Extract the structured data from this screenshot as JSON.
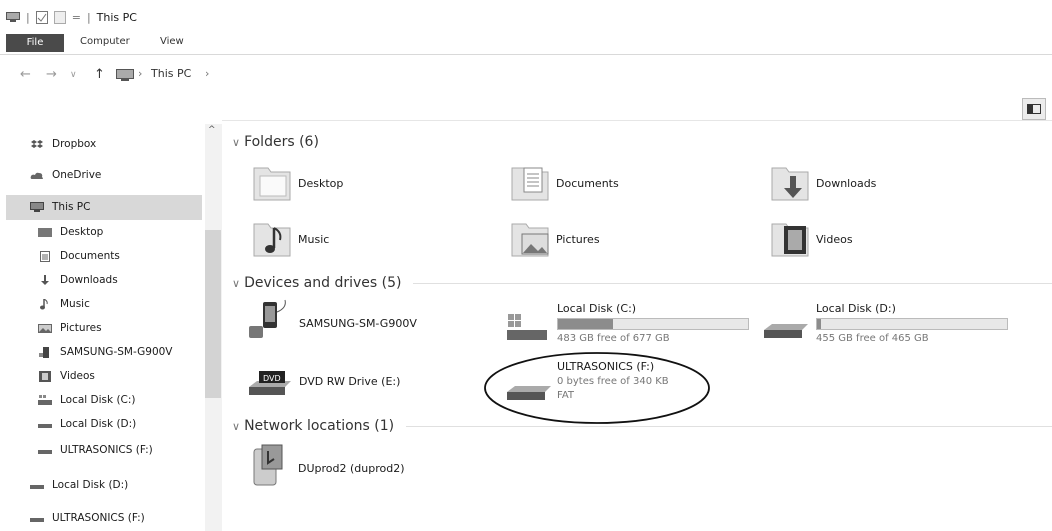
{
  "window": {
    "title": "This PC"
  },
  "ribbon": {
    "tabs": [
      "File",
      "Computer",
      "View"
    ]
  },
  "address": {
    "crumbs": [
      "This PC"
    ]
  },
  "nav_pane": {
    "items": [
      {
        "label": "Dropbox"
      },
      {
        "label": "OneDrive"
      },
      {
        "label": "This PC"
      },
      {
        "label": "Desktop"
      },
      {
        "label": "Documents"
      },
      {
        "label": "Downloads"
      },
      {
        "label": "Music"
      },
      {
        "label": "Pictures"
      },
      {
        "label": "SAMSUNG-SM-G900V"
      },
      {
        "label": "Videos"
      },
      {
        "label": "Local Disk (C:)"
      },
      {
        "label": "Local Disk (D:)"
      },
      {
        "label": "ULTRASONICS (F:)"
      },
      {
        "label": "Local Disk (D:)"
      },
      {
        "label": "ULTRASONICS (F:)"
      }
    ]
  },
  "content": {
    "folders_header": "Folders (6)",
    "folders": [
      "Desktop",
      "Documents",
      "Downloads",
      "Music",
      "Pictures",
      "Videos"
    ],
    "devices_header": "Devices and drives (5)",
    "devices": {
      "samsung": "SAMSUNG-SM-G900V",
      "dvd": "DVD RW Drive (E:)",
      "dvd_badge": "DVD",
      "c": {
        "name": "Local Disk (C:)",
        "free": "483 GB free of 677 GB",
        "used_fraction": 0.29
      },
      "d": {
        "name": "Local Disk (D:)",
        "free": "455 GB free of 465 GB",
        "used_fraction": 0.02
      },
      "f": {
        "name": "ULTRASONICS (F:)",
        "free": "0 bytes free of 340 KB",
        "fs": "FAT"
      }
    },
    "network_header": "Network locations (1)",
    "network": [
      "DUprod2 (duprod2)"
    ]
  }
}
